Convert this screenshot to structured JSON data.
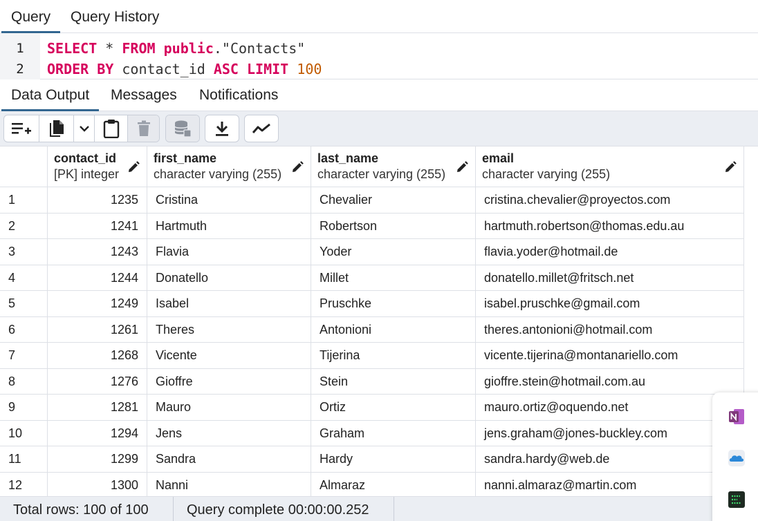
{
  "top_tabs": [
    "Query",
    "Query History"
  ],
  "editor": {
    "line_numbers": [
      "1",
      "2"
    ],
    "line1": {
      "kw1": "SELECT",
      "star": "*",
      "kw2": "FROM",
      "schema": "public",
      "dot": ".",
      "table": "\"Contacts\""
    },
    "line2": {
      "kw1": "ORDER BY",
      "col": "contact_id",
      "kw2": "ASC",
      "kw3": "LIMIT",
      "limit": "100"
    }
  },
  "output_tabs": [
    "Data Output",
    "Messages",
    "Notifications"
  ],
  "toolbar": {
    "buttons": [
      "add-row-icon",
      "copy-icon",
      "chevron-down-icon",
      "paste-icon",
      "delete-icon",
      "save-data-icon",
      "download-icon",
      "graph-visualiser-icon"
    ]
  },
  "columns": [
    {
      "name": "",
      "type": ""
    },
    {
      "name": "contact_id",
      "type": "[PK] integer"
    },
    {
      "name": "first_name",
      "type": "character varying (255)"
    },
    {
      "name": "last_name",
      "type": "character varying (255)"
    },
    {
      "name": "email",
      "type": "character varying (255)"
    }
  ],
  "rows": [
    [
      "1",
      "1235",
      "Cristina",
      "Chevalier",
      "cristina.chevalier@proyectos.com"
    ],
    [
      "2",
      "1241",
      "Hartmuth",
      "Robertson",
      "hartmuth.robertson@thomas.edu.au"
    ],
    [
      "3",
      "1243",
      "Flavia",
      "Yoder",
      "flavia.yoder@hotmail.de"
    ],
    [
      "4",
      "1244",
      "Donatello",
      "Millet",
      "donatello.millet@fritsch.net"
    ],
    [
      "5",
      "1249",
      "Isabel",
      "Pruschke",
      "isabel.pruschke@gmail.com"
    ],
    [
      "6",
      "1261",
      "Theres",
      "Antonioni",
      "theres.antonioni@hotmail.com"
    ],
    [
      "7",
      "1268",
      "Vicente",
      "Tijerina",
      "vicente.tijerina@montanariello.com"
    ],
    [
      "8",
      "1276",
      "Gioffre",
      "Stein",
      "gioffre.stein@hotmail.com.au"
    ],
    [
      "9",
      "1281",
      "Mauro",
      "Ortiz",
      "mauro.ortiz@oquendo.net"
    ],
    [
      "10",
      "1294",
      "Jens",
      "Graham",
      "jens.graham@jones-buckley.com"
    ],
    [
      "11",
      "1299",
      "Sandra",
      "Hardy",
      "sandra.hardy@web.de"
    ],
    [
      "12",
      "1300",
      "Nanni",
      "Almaraz",
      "nanni.almaraz@martin.com"
    ]
  ],
  "status": {
    "total_rows": "Total rows: 100 of 100",
    "query_complete": "Query complete 00:00:00.252"
  },
  "dock": [
    "onenote-icon",
    "onedrive-icon",
    "terminal-app-icon"
  ],
  "colors": {
    "keyword": "#d6005c",
    "number": "#c15a00",
    "accent": "#326690"
  }
}
